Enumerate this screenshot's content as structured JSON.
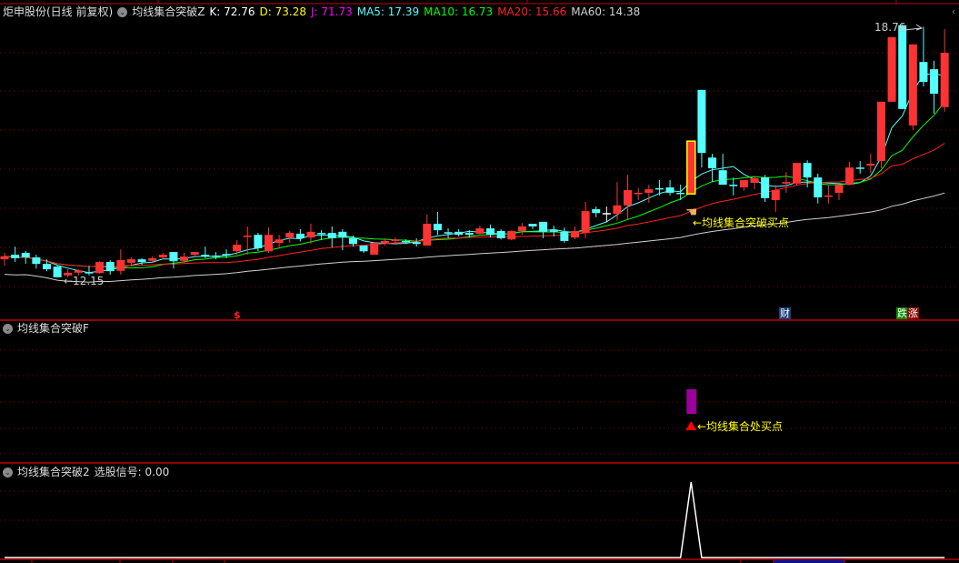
{
  "header": {
    "stock": "炬申股份(日线 前复权)",
    "indicator": "均线集合突破Z",
    "k": "K: 72.76",
    "d": "D: 73.28",
    "j": "J: 71.73",
    "ma5": "MA5: 17.39",
    "ma10": "MA10: 16.73",
    "ma20": "MA20: 15.66",
    "ma60": "MA60: 14.38"
  },
  "pane2": {
    "title": "均线集合突破F",
    "annotation": "←均线集合处买点"
  },
  "pane3": {
    "title": "均线集合突破2",
    "signal_label": "选股信号: 0.00"
  },
  "annotations": {
    "low_label": "←12.15",
    "high_label": "18.76",
    "buy_label": "←均线集合突破买点",
    "dollar_tag": "$",
    "finance_tag": "财",
    "rise_fall_tag_a": "跌",
    "rise_fall_tag_b": "涨"
  },
  "colors": {
    "up": "#ff3333",
    "down": "#54ffff",
    "ma5": "#54ffff",
    "ma10": "#00ff00",
    "ma20": "#ff2020",
    "ma60": "#d0d0d0",
    "grid": "#8b0000",
    "k": "#ffffff",
    "d": "#ffff00",
    "j": "#ff00ff",
    "signal": "#990099",
    "text_yellow": "#ffff00"
  },
  "chart_data": {
    "type": "candlestick",
    "title": "炬申股份(日线 前复权)",
    "price_range": [
      12.15,
      18.76
    ],
    "ohlc": [
      [
        12.62,
        12.7,
        12.79,
        12.45
      ],
      [
        12.74,
        12.65,
        12.95,
        12.55
      ],
      [
        12.79,
        12.67,
        12.84,
        12.5
      ],
      [
        12.67,
        12.5,
        12.74,
        12.38
      ],
      [
        12.5,
        12.36,
        12.62,
        12.31
      ],
      [
        12.43,
        12.15,
        12.45,
        12.15
      ],
      [
        12.2,
        12.27,
        12.36,
        12.15
      ],
      [
        12.27,
        12.33,
        12.36,
        12.2
      ],
      [
        12.29,
        12.25,
        12.45,
        12.2
      ],
      [
        12.26,
        12.55,
        12.57,
        12.24
      ],
      [
        12.55,
        12.31,
        12.6,
        12.22
      ],
      [
        12.32,
        12.6,
        12.88,
        12.22
      ],
      [
        12.53,
        12.62,
        12.67,
        12.43
      ],
      [
        12.62,
        12.55,
        12.65,
        12.48
      ],
      [
        12.58,
        12.65,
        12.7,
        12.55
      ],
      [
        12.67,
        12.74,
        12.79,
        12.62
      ],
      [
        12.81,
        12.57,
        12.81,
        12.38
      ],
      [
        12.58,
        12.69,
        12.79,
        12.5
      ],
      [
        12.74,
        12.81,
        12.81,
        12.67
      ],
      [
        12.74,
        12.7,
        12.95,
        12.65
      ],
      [
        12.72,
        12.69,
        12.81,
        12.62
      ],
      [
        12.76,
        12.72,
        12.88,
        12.65
      ],
      [
        12.83,
        13.0,
        13.12,
        12.74
      ],
      [
        13.22,
        13.24,
        13.48,
        12.74
      ],
      [
        13.26,
        12.91,
        13.31,
        12.83
      ],
      [
        12.83,
        13.26,
        13.45,
        12.79
      ],
      [
        13.05,
        13.14,
        13.26,
        12.91
      ],
      [
        13.19,
        13.31,
        13.36,
        13.05
      ],
      [
        13.29,
        13.17,
        13.41,
        13.09
      ],
      [
        13.19,
        13.34,
        13.55,
        13.02
      ],
      [
        13.31,
        13.29,
        13.38,
        13.12
      ],
      [
        13.31,
        13.17,
        13.48,
        12.93
      ],
      [
        13.34,
        13.19,
        13.41,
        12.86
      ],
      [
        13.17,
        13.02,
        13.24,
        12.95
      ],
      [
        12.98,
        12.83,
        12.98,
        12.79
      ],
      [
        12.74,
        13.05,
        13.07,
        12.74
      ],
      [
        13.05,
        13.1,
        13.17,
        12.98
      ],
      [
        13.1,
        13.14,
        13.19,
        13.0
      ],
      [
        13.1,
        13.07,
        13.14,
        13.02
      ],
      [
        13.07,
        13.02,
        13.17,
        12.95
      ],
      [
        12.98,
        13.55,
        13.79,
        12.98
      ],
      [
        13.55,
        13.38,
        13.86,
        13.26
      ],
      [
        13.33,
        13.31,
        13.43,
        13.17
      ],
      [
        13.34,
        13.26,
        13.41,
        13.22
      ],
      [
        13.31,
        13.26,
        13.38,
        13.19
      ],
      [
        13.29,
        13.43,
        13.5,
        13.24
      ],
      [
        13.43,
        13.26,
        13.53,
        13.19
      ],
      [
        13.36,
        13.17,
        13.41,
        13.14
      ],
      [
        13.14,
        13.36,
        13.38,
        13.12
      ],
      [
        13.36,
        13.48,
        13.57,
        13.26
      ],
      [
        13.55,
        13.48,
        13.55,
        13.41
      ],
      [
        13.6,
        13.34,
        13.6,
        13.17
      ],
      [
        13.38,
        13.34,
        13.5,
        13.22
      ],
      [
        13.34,
        13.1,
        13.45,
        13.05
      ],
      [
        13.19,
        13.36,
        13.48,
        13.14
      ],
      [
        13.31,
        13.88,
        14.12,
        13.17
      ],
      [
        13.93,
        13.83,
        14.0,
        13.72
      ],
      [
        13.83,
        13.83,
        14.0,
        13.6
      ],
      [
        13.81,
        14.03,
        14.64,
        13.64
      ],
      [
        14.03,
        14.43,
        14.83,
        13.67
      ],
      [
        14.33,
        14.36,
        14.48,
        14.17
      ],
      [
        14.36,
        14.45,
        14.57,
        14.1
      ],
      [
        14.48,
        14.45,
        14.69,
        14.29
      ],
      [
        14.5,
        14.36,
        14.69,
        14.29
      ],
      [
        14.36,
        14.33,
        14.57,
        14.17
      ],
      [
        14.33,
        15.71,
        15.71,
        14.33
      ],
      [
        17.05,
        15.4,
        17.05,
        15.02
      ],
      [
        15.28,
        15.0,
        15.38,
        14.64
      ],
      [
        14.95,
        14.57,
        15.38,
        14.57
      ],
      [
        14.57,
        14.55,
        14.76,
        14.29
      ],
      [
        14.5,
        14.69,
        14.69,
        14.41
      ],
      [
        14.62,
        14.74,
        14.81,
        14.45
      ],
      [
        14.76,
        14.22,
        14.83,
        14.12
      ],
      [
        14.17,
        14.43,
        14.57,
        13.86
      ],
      [
        14.6,
        14.64,
        14.9,
        14.36
      ],
      [
        14.6,
        15.14,
        15.14,
        14.55
      ],
      [
        15.14,
        14.76,
        15.21,
        14.5
      ],
      [
        14.76,
        14.24,
        14.86,
        14.08
      ],
      [
        14.27,
        14.29,
        14.55,
        14.08
      ],
      [
        14.36,
        14.57,
        14.57,
        14.17
      ],
      [
        14.57,
        15.02,
        15.17,
        14.57
      ],
      [
        15.02,
        15.0,
        15.19,
        14.86
      ],
      [
        15.07,
        15.12,
        15.38,
        14.88
      ],
      [
        15.19,
        16.74,
        16.74,
        15.0
      ],
      [
        16.74,
        18.43,
        18.43,
        16.74
      ],
      [
        18.74,
        16.55,
        18.76,
        16.55
      ],
      [
        16.12,
        18.24,
        18.24,
        16.0
      ],
      [
        17.78,
        17.26,
        18.7,
        17.14
      ],
      [
        17.59,
        16.95,
        17.81,
        16.43
      ],
      [
        16.6,
        18.02,
        18.64,
        16.48
      ]
    ],
    "moving_averages": [
      5,
      10,
      20,
      60
    ],
    "low_point": {
      "index": 5,
      "value": 12.15
    },
    "high_point": {
      "index": 85,
      "value": 18.76
    },
    "buy_signal_index": 65,
    "signal2_values_nonzero": {
      "index": 65,
      "value": 1
    }
  }
}
